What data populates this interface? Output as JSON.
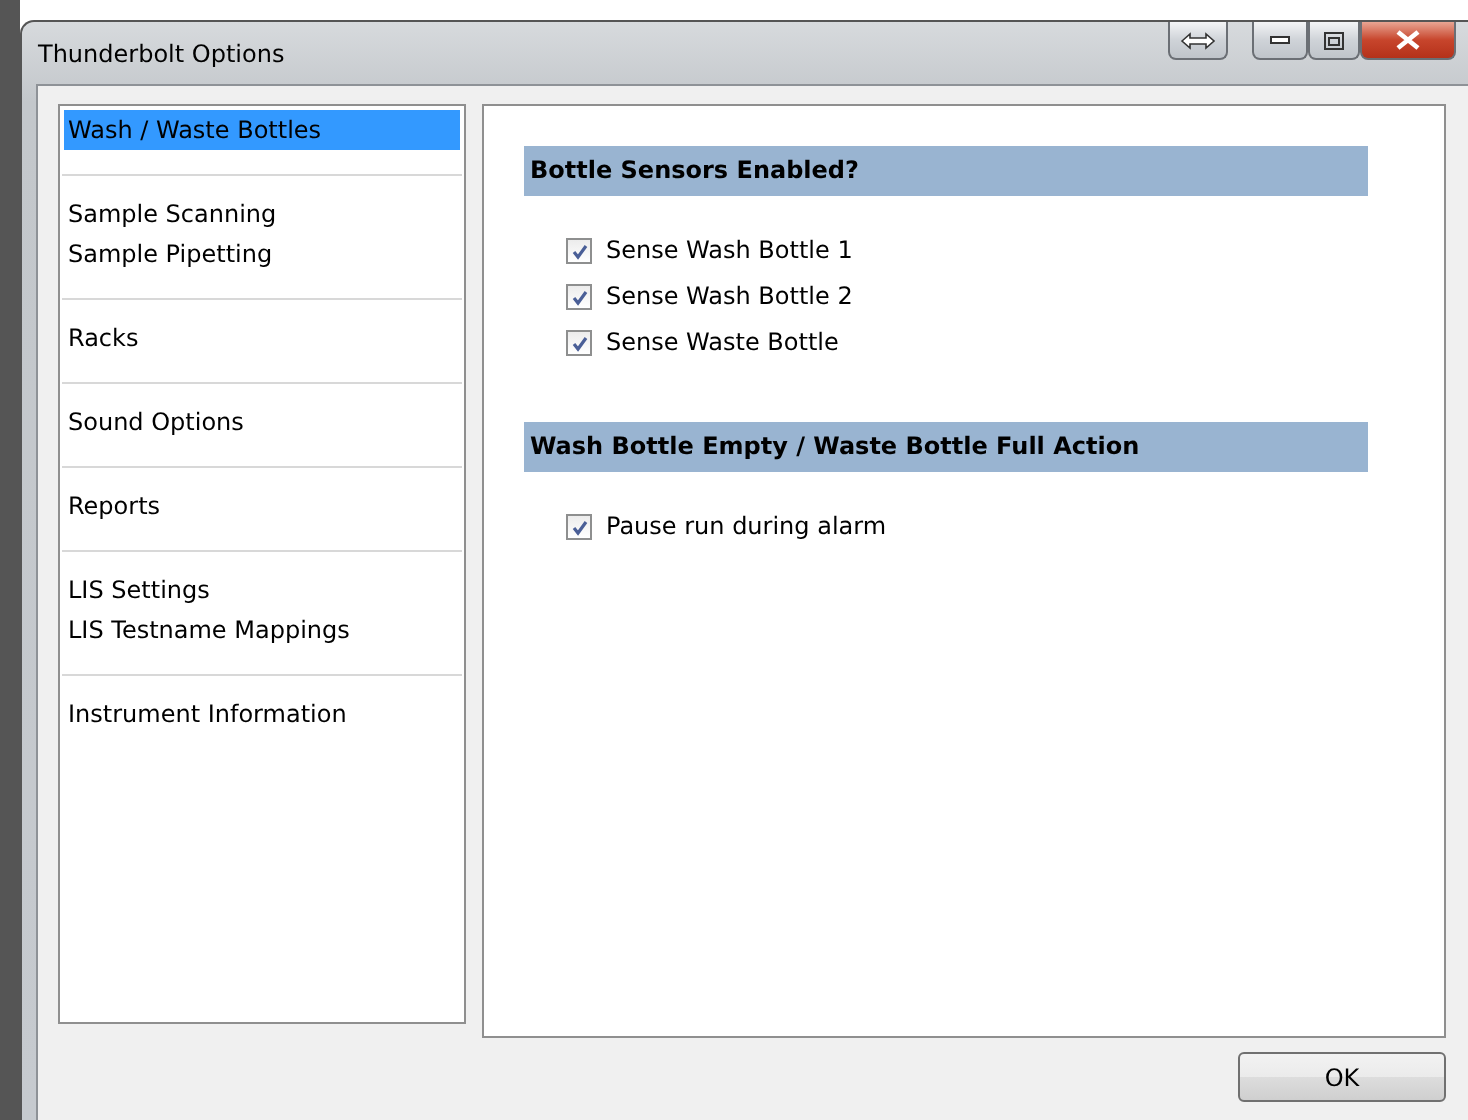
{
  "window": {
    "title": "Thunderbolt Options"
  },
  "sidebar": {
    "groups": [
      {
        "items": [
          {
            "label": "Wash / Waste Bottles",
            "selected": true
          }
        ]
      },
      {
        "items": [
          {
            "label": "Sample Scanning",
            "selected": false
          },
          {
            "label": "Sample Pipetting",
            "selected": false
          }
        ]
      },
      {
        "items": [
          {
            "label": "Racks",
            "selected": false
          }
        ]
      },
      {
        "items": [
          {
            "label": "Sound Options",
            "selected": false
          }
        ]
      },
      {
        "items": [
          {
            "label": "Reports",
            "selected": false
          }
        ]
      },
      {
        "items": [
          {
            "label": "LIS Settings",
            "selected": false
          },
          {
            "label": "LIS Testname Mappings",
            "selected": false
          }
        ]
      },
      {
        "items": [
          {
            "label": "Instrument Information",
            "selected": false
          }
        ]
      }
    ]
  },
  "sections": [
    {
      "heading": "Bottle Sensors Enabled?",
      "options": [
        {
          "label": "Sense Wash Bottle 1",
          "checked": true
        },
        {
          "label": "Sense Wash Bottle 2",
          "checked": true
        },
        {
          "label": "Sense Waste Bottle",
          "checked": true
        }
      ]
    },
    {
      "heading": "Wash Bottle Empty / Waste Bottle Full Action",
      "options": [
        {
          "label": "Pause run during alarm",
          "checked": true
        }
      ]
    }
  ],
  "buttons": [
    {
      "label": "OK"
    }
  ]
}
